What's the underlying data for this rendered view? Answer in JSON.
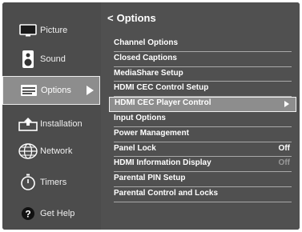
{
  "sidebar": {
    "items": [
      {
        "label": "Picture",
        "icon": "picture-icon",
        "selected": false
      },
      {
        "label": "Sound",
        "icon": "speaker-icon",
        "selected": false
      },
      {
        "label": "Options",
        "icon": "options-icon",
        "selected": true
      },
      {
        "label": "Installation",
        "icon": "installation-icon",
        "selected": false
      },
      {
        "label": "Network",
        "icon": "globe-network-icon",
        "selected": false
      },
      {
        "label": "Timers",
        "icon": "timer-icon",
        "selected": false
      },
      {
        "label": "Get Help",
        "icon": "help-icon",
        "selected": false
      }
    ]
  },
  "panel": {
    "back_glyph": "<",
    "title": "Options",
    "items": [
      {
        "label": "Channel Options",
        "value": ""
      },
      {
        "label": "Closed Captions",
        "value": ""
      },
      {
        "label": "MediaShare Setup",
        "value": ""
      },
      {
        "label": "HDMI CEC Control Setup",
        "value": ""
      },
      {
        "label": "HDMI CEC Player Control",
        "value": "",
        "selected": true
      },
      {
        "label": "Input Options",
        "value": ""
      },
      {
        "label": "Power Management",
        "value": ""
      },
      {
        "label": "Panel Lock",
        "value": "Off"
      },
      {
        "label": "HDMI Information Display",
        "value": "Off",
        "disabled_value": true
      },
      {
        "label": "Parental PIN Setup",
        "value": ""
      },
      {
        "label": "Parental Control and Locks",
        "value": ""
      }
    ]
  },
  "colors": {
    "background": "#4c4c4c",
    "selected": "#8d8d8d",
    "text": "#ffffff",
    "dim_text": "#999999",
    "divider": "#a8a8a8"
  }
}
